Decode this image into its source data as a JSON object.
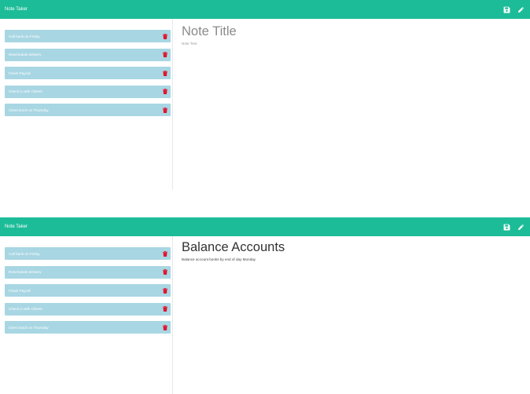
{
  "screens": [
    {
      "brand": "Note Taker",
      "notes": [
        {
          "title": "Call bank on Friday"
        },
        {
          "title": "Reschedule delivery"
        },
        {
          "title": "Finish Payroll"
        },
        {
          "title": "Check in with Clients"
        },
        {
          "title": "Client lunch on Thursday"
        }
      ],
      "editor": {
        "title_placeholder": "Note Title",
        "text_placeholder": "Note Text",
        "title_value": "",
        "text_value": ""
      }
    },
    {
      "brand": "Note Taker",
      "notes": [
        {
          "title": "Call bank on Friday"
        },
        {
          "title": "Reschedule delivery"
        },
        {
          "title": "Finish Payroll"
        },
        {
          "title": "Check in with Clients"
        },
        {
          "title": "Client lunch on Thursday"
        }
      ],
      "editor": {
        "title_placeholder": "",
        "text_placeholder": "",
        "title_value": "Balance Accounts",
        "text_value": "Balance account books by end of day Monday"
      }
    }
  ],
  "icons": {
    "save": "save-icon",
    "edit": "pencil-icon",
    "delete": "trash-icon"
  },
  "colors": {
    "navbar": "#1dbc98",
    "note_item": "#a8d6e3",
    "delete": "#e0162f"
  }
}
